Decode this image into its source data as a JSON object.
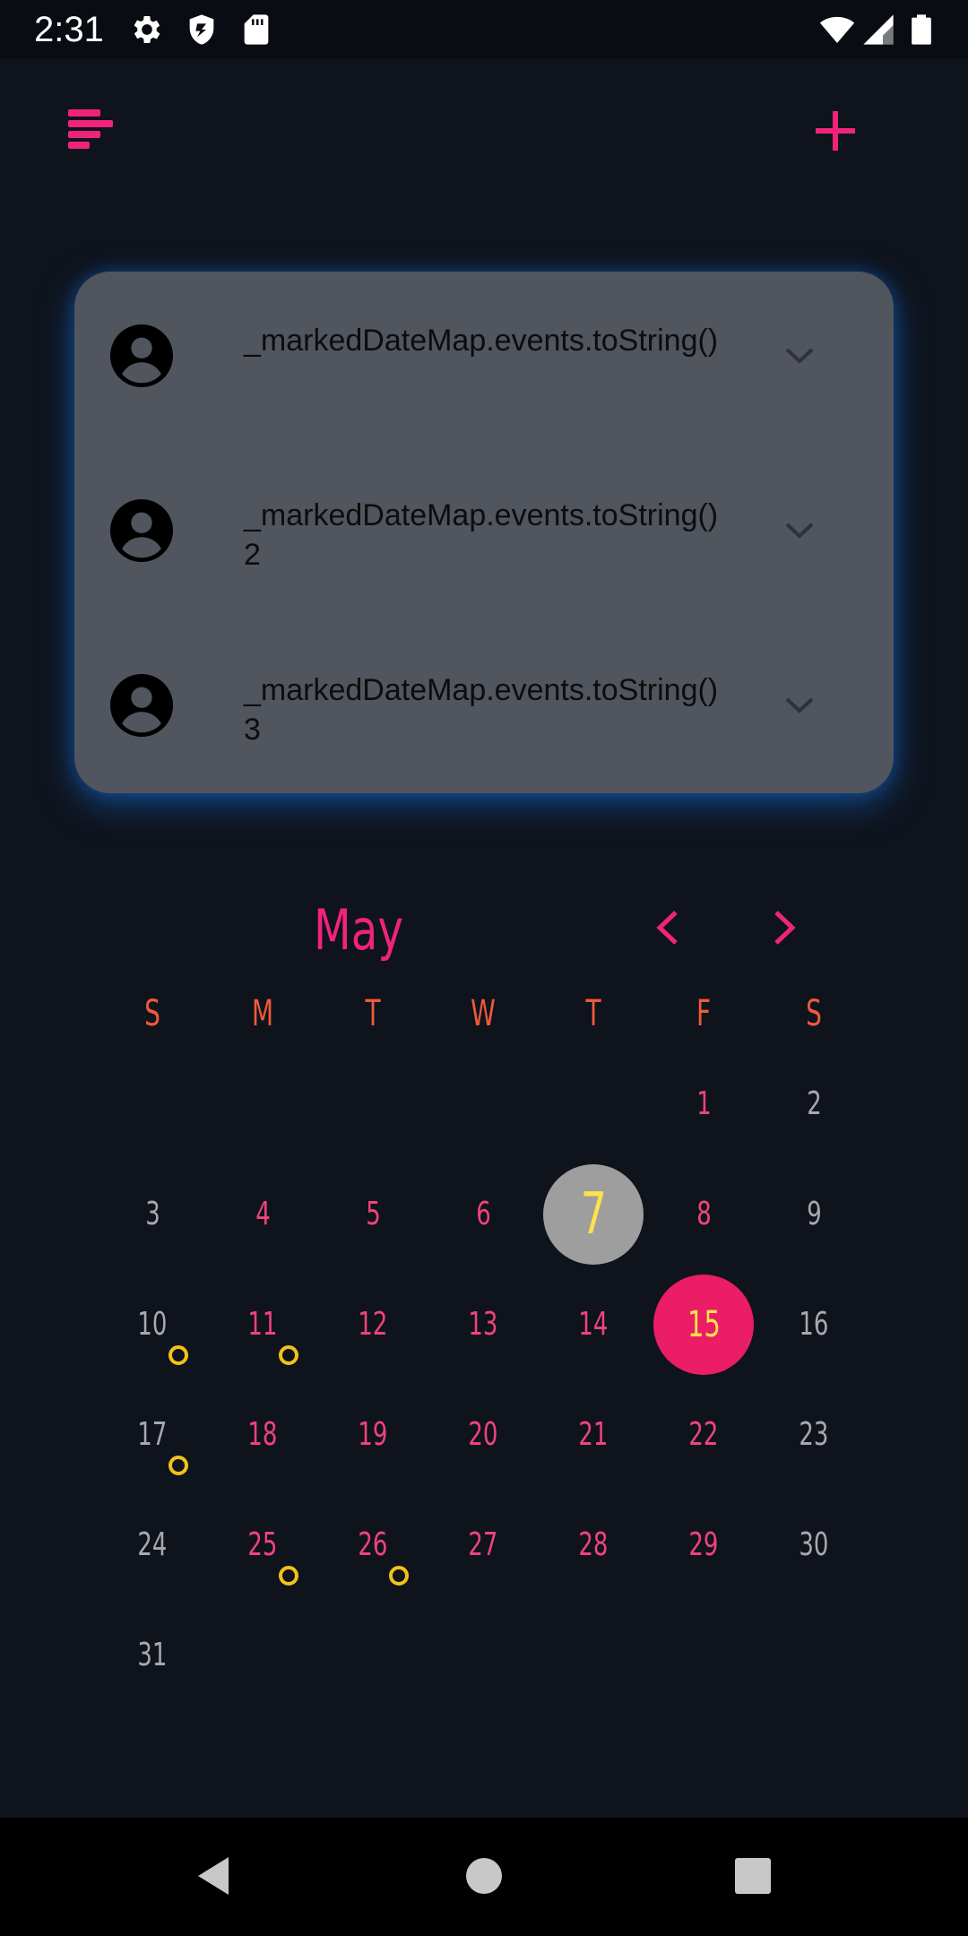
{
  "status_bar": {
    "time": "2:31",
    "icons": [
      "gear-icon",
      "shield-icon",
      "sd-card-icon",
      "wifi-icon",
      "signal-icon",
      "battery-icon"
    ]
  },
  "app_bar": {
    "menu_icon": "sort-menu-icon",
    "add_icon": "plus-icon",
    "accent_color": "#f0237a"
  },
  "events": [
    {
      "title": "_markedDateMap.events.toString()",
      "icon": "account-circle-icon"
    },
    {
      "title": "_markedDateMap.events.toString()2",
      "icon": "account-circle-icon"
    },
    {
      "title": "_markedDateMap.events.toString()3",
      "icon": "account-circle-icon"
    }
  ],
  "calendar": {
    "month": "May",
    "weekdays": [
      "S",
      "M",
      "T",
      "W",
      "T",
      "F",
      "S"
    ],
    "today": 7,
    "selected": 15,
    "days_with_events": [
      10,
      11,
      17,
      25,
      26
    ],
    "weeks": [
      [
        "",
        "",
        "",
        "",
        "",
        "1",
        "2"
      ],
      [
        "3",
        "4",
        "5",
        "6",
        "7",
        "8",
        "9"
      ],
      [
        "10",
        "11",
        "12",
        "13",
        "14",
        "15",
        "16"
      ],
      [
        "17",
        "18",
        "19",
        "20",
        "21",
        "22",
        "23"
      ],
      [
        "24",
        "25",
        "26",
        "27",
        "28",
        "29",
        "30"
      ],
      [
        "31",
        "",
        "",
        "",
        "",
        "",
        ""
      ]
    ],
    "colors": {
      "month_title": "#f0237a",
      "weekday_header": "#ee5a3a",
      "weekday_day": "#f0437c",
      "weekend_day": "#a8a9ae",
      "today_bg": "#9e9e9e",
      "selected_bg": "#ea1d66",
      "day_highlight_text": "#ffe14a",
      "event_dot": "#f2c21b"
    }
  },
  "navigation_bar": {
    "icons": [
      "back-icon",
      "home-icon",
      "recents-icon"
    ]
  }
}
